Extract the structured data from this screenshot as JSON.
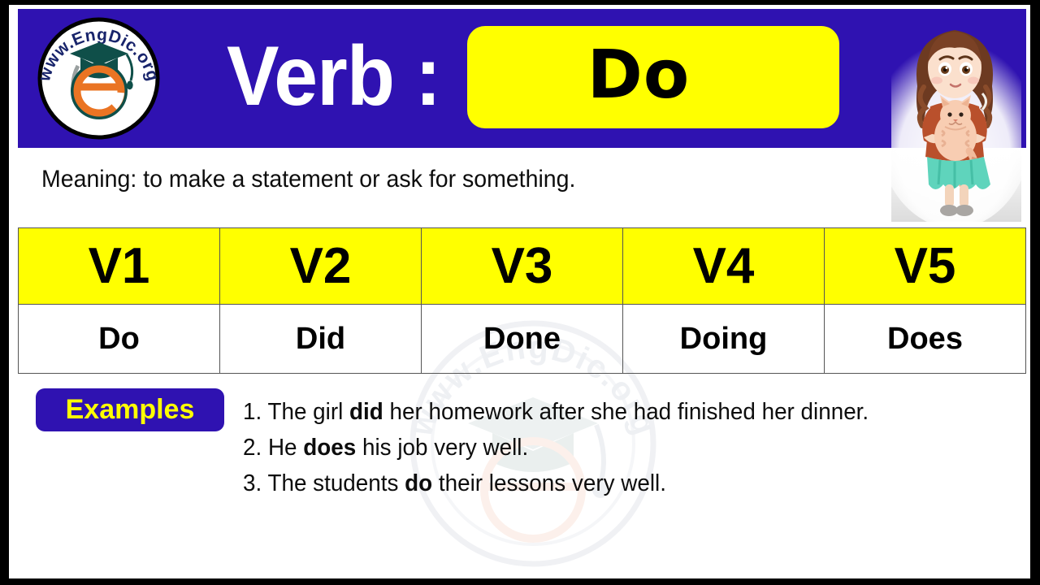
{
  "brand": {
    "logo_text": "www.EngDic.org",
    "logo_icon": "graduation-cap-e-badge-icon"
  },
  "header": {
    "label": "Verb :",
    "verb": "Do",
    "band_color": "#2f12b1",
    "verb_box_color": "#ffff00",
    "illustration": "girl-holding-cat-illustration"
  },
  "meaning": {
    "text": "Meaning: to make a statement or ask for something."
  },
  "table": {
    "headers": [
      "V1",
      "V2",
      "V3",
      "V4",
      "V5"
    ],
    "forms": [
      "Do",
      "Did",
      "Done",
      "Doing",
      "Does"
    ],
    "header_bg": "#ffff00"
  },
  "examples": {
    "badge_label": "Examples",
    "badge_bg": "#2f12b1",
    "badge_color": "#ffff00",
    "items": [
      {
        "number": "1.",
        "before": " The girl ",
        "bold": "did",
        "after": " her homework after she had finished her dinner."
      },
      {
        "number": "2.",
        "before": " He ",
        "bold": "does",
        "after": " his job very well."
      },
      {
        "number": "3.",
        "before": " The students ",
        "bold": "do",
        "after": " their lessons very well."
      }
    ]
  },
  "watermark": {
    "text": "www.EngDic.org"
  }
}
